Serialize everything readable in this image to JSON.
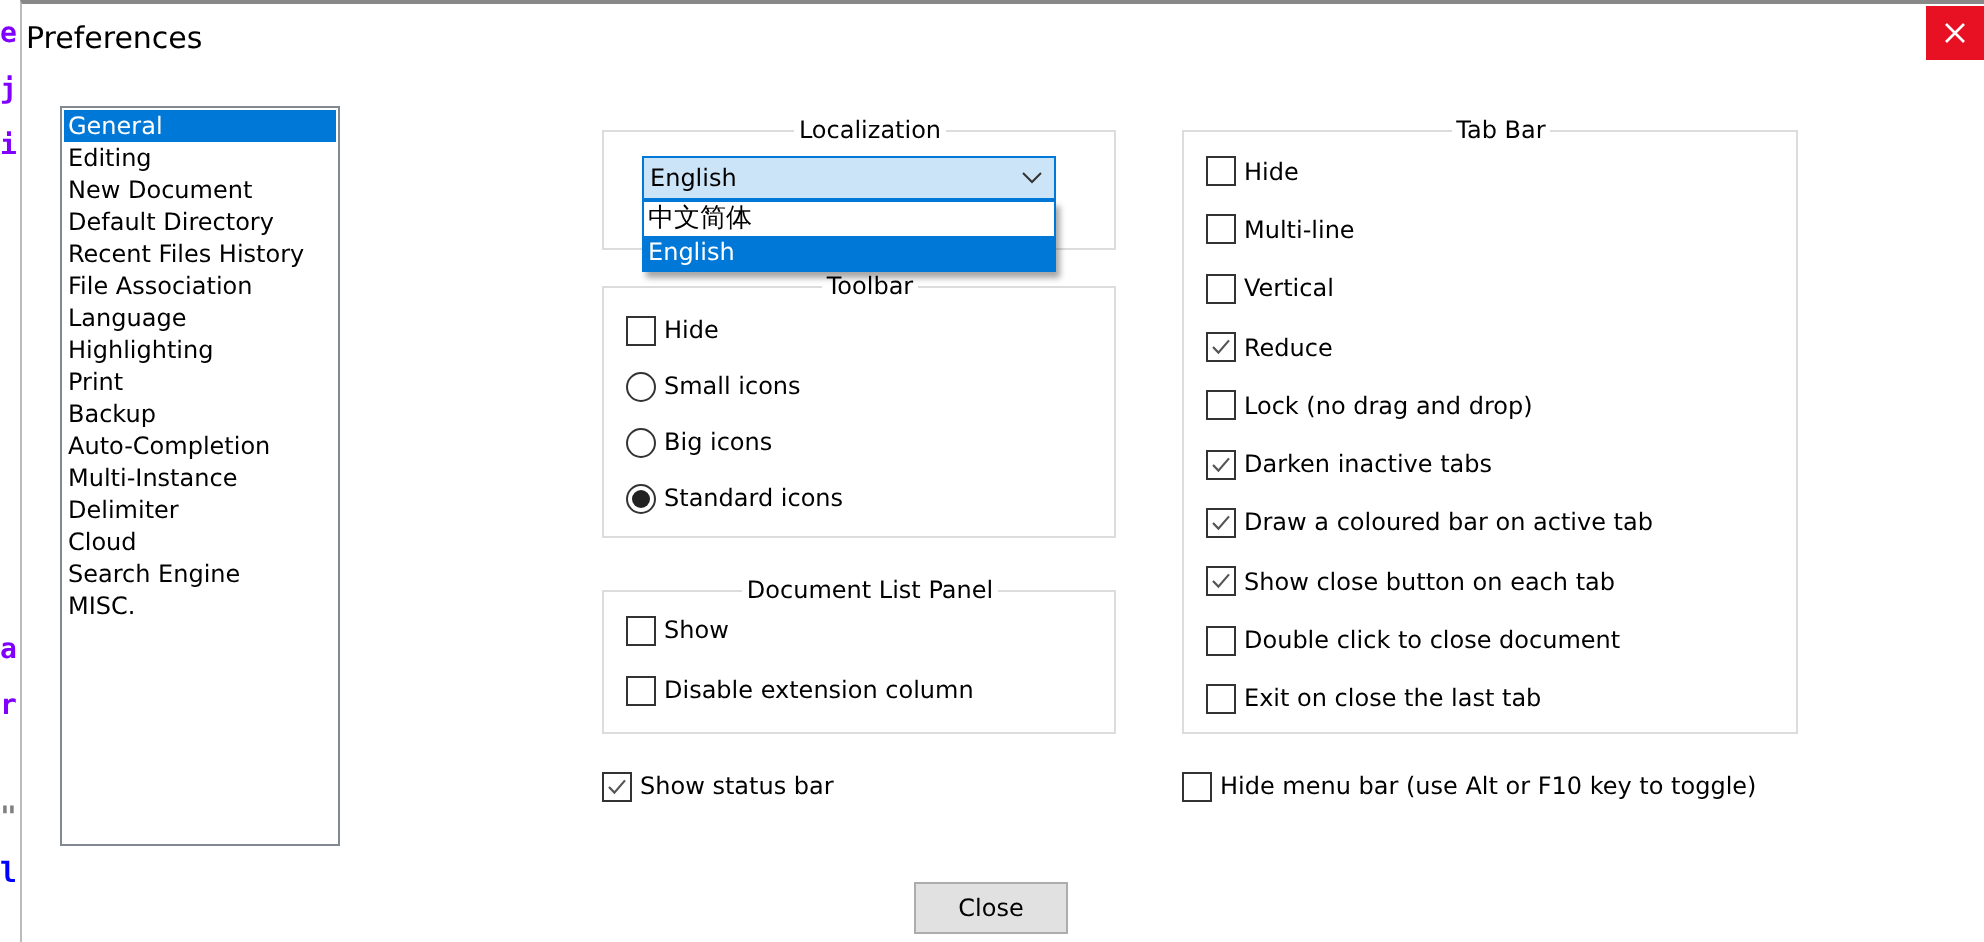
{
  "window": {
    "title": "Preferences"
  },
  "editor_behind": {
    "lines": [
      {
        "kind": "code",
        "text": "e",
        "color": "#8000ff"
      },
      {
        "kind": "code",
        "text": "j",
        "color": "#8000ff"
      },
      {
        "kind": "code",
        "text": "i",
        "color": "#8000ff"
      },
      {
        "kind": "blank"
      },
      {
        "kind": "blank"
      },
      {
        "kind": "blank"
      },
      {
        "kind": "blank"
      },
      {
        "kind": "blank"
      },
      {
        "kind": "blank"
      },
      {
        "kind": "blank"
      },
      {
        "kind": "blank"
      },
      {
        "kind": "code",
        "text": "a",
        "color": "#8000ff"
      },
      {
        "kind": "code",
        "text": "r",
        "color": "#8000ff"
      },
      {
        "kind": "blank"
      },
      {
        "kind": "code",
        "text": "\"",
        "color": "#808080"
      },
      {
        "kind": "code",
        "text": "l",
        "color": "#0000ff"
      }
    ]
  },
  "categories": [
    {
      "label": "General",
      "selected": true
    },
    {
      "label": "Editing",
      "selected": false
    },
    {
      "label": "New Document",
      "selected": false
    },
    {
      "label": "Default Directory",
      "selected": false
    },
    {
      "label": "Recent Files History",
      "selected": false
    },
    {
      "label": "File Association",
      "selected": false
    },
    {
      "label": "Language",
      "selected": false
    },
    {
      "label": "Highlighting",
      "selected": false
    },
    {
      "label": "Print",
      "selected": false
    },
    {
      "label": "Backup",
      "selected": false
    },
    {
      "label": "Auto-Completion",
      "selected": false
    },
    {
      "label": "Multi-Instance",
      "selected": false
    },
    {
      "label": "Delimiter",
      "selected": false
    },
    {
      "label": "Cloud",
      "selected": false
    },
    {
      "label": "Search Engine",
      "selected": false
    },
    {
      "label": "MISC.",
      "selected": false
    }
  ],
  "localization": {
    "title": "Localization",
    "value": "English",
    "options": [
      {
        "label": "中文简体",
        "selected": false
      },
      {
        "label": "English",
        "selected": true
      }
    ]
  },
  "toolbar": {
    "title": "Toolbar",
    "options": [
      {
        "kind": "checkbox",
        "label": "Hide",
        "checked": false
      },
      {
        "kind": "radio",
        "label": "Small icons",
        "selected": false
      },
      {
        "kind": "radio",
        "label": "Big icons",
        "selected": false
      },
      {
        "kind": "radio",
        "label": "Standard icons",
        "selected": true
      }
    ]
  },
  "document_list_panel": {
    "title": "Document List Panel",
    "options": [
      {
        "kind": "checkbox",
        "label": "Show",
        "checked": false
      },
      {
        "kind": "checkbox",
        "label": "Disable extension column",
        "checked": false
      }
    ]
  },
  "show_status_bar": {
    "label": "Show status bar",
    "checked": true
  },
  "tab_bar": {
    "title": "Tab Bar",
    "options": [
      {
        "kind": "checkbox",
        "label": "Hide",
        "checked": false
      },
      {
        "kind": "checkbox",
        "label": "Multi-line",
        "checked": false
      },
      {
        "kind": "checkbox",
        "label": "Vertical",
        "checked": false
      },
      {
        "kind": "checkbox",
        "label": "Reduce",
        "checked": true
      },
      {
        "kind": "checkbox",
        "label": "Lock (no drag and drop)",
        "checked": false
      },
      {
        "kind": "checkbox",
        "label": "Darken inactive tabs",
        "checked": true
      },
      {
        "kind": "checkbox",
        "label": "Draw a coloured bar on active tab",
        "checked": true
      },
      {
        "kind": "checkbox",
        "label": "Show close button on each tab",
        "checked": true
      },
      {
        "kind": "checkbox",
        "label": "Double click to close document",
        "checked": false
      },
      {
        "kind": "checkbox",
        "label": "Exit on close the last tab",
        "checked": false
      }
    ]
  },
  "hide_menu_bar": {
    "label": "Hide menu bar (use Alt or F10 key to toggle)",
    "checked": false
  },
  "buttons": [
    {
      "label": "Close"
    }
  ]
}
